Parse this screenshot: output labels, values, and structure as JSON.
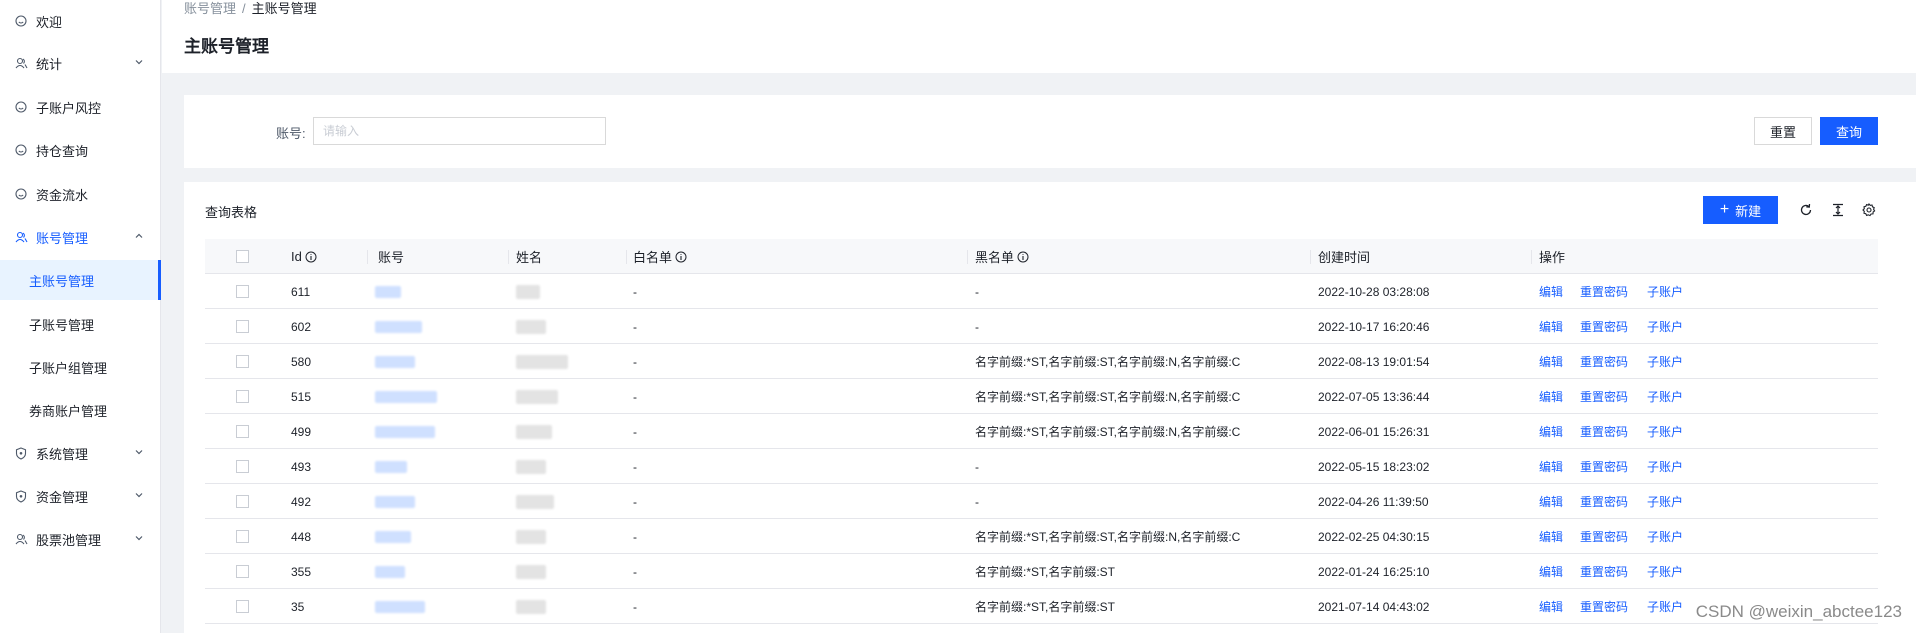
{
  "sidebar": {
    "items": [
      {
        "label": "欢迎",
        "icon": "smile-icon"
      },
      {
        "label": "统计",
        "icon": "user-group-icon",
        "expandable": true
      },
      {
        "label": "子账户风控",
        "icon": "smile-icon"
      },
      {
        "label": "持仓查询",
        "icon": "smile-icon"
      },
      {
        "label": "资金流水",
        "icon": "smile-icon"
      },
      {
        "label": "账号管理",
        "icon": "user-group-icon",
        "expandable": true,
        "open": true
      },
      {
        "label": "主账号管理",
        "sub": true,
        "active": true
      },
      {
        "label": "子账号管理",
        "sub": true
      },
      {
        "label": "子账户组管理",
        "sub": true
      },
      {
        "label": "券商账户管理",
        "sub": true
      },
      {
        "label": "系统管理",
        "icon": "shield-icon",
        "expandable": true
      },
      {
        "label": "资金管理",
        "icon": "shield-icon",
        "expandable": true
      },
      {
        "label": "股票池管理",
        "icon": "user-group-icon",
        "expandable": true
      }
    ]
  },
  "header": {
    "breadcrumb": [
      "账号管理",
      "主账号管理"
    ],
    "title": "主账号管理"
  },
  "search": {
    "label": "账号:",
    "placeholder": "请输入",
    "value": "",
    "reset_label": "重置",
    "query_label": "查询"
  },
  "table": {
    "title": "查询表格",
    "new_label": "新建",
    "tools": [
      "refresh-icon",
      "column-height-icon",
      "settings-icon"
    ],
    "columns": [
      "Id",
      "账号",
      "姓名",
      "白名单",
      "黑名单",
      "创建时间",
      "操作"
    ],
    "actions": [
      "编辑",
      "重置密码",
      "子账户"
    ],
    "rows": [
      {
        "id": "611",
        "whitelist": "-",
        "blacklist": "-",
        "created": "2022-10-28 03:28:08"
      },
      {
        "id": "602",
        "whitelist": "-",
        "blacklist": "-",
        "created": "2022-10-17 16:20:46"
      },
      {
        "id": "580",
        "whitelist": "-",
        "blacklist": "名字前缀:*ST,名字前缀:ST,名字前缀:N,名字前缀:C",
        "created": "2022-08-13 19:01:54"
      },
      {
        "id": "515",
        "whitelist": "-",
        "blacklist": "名字前缀:*ST,名字前缀:ST,名字前缀:N,名字前缀:C",
        "created": "2022-07-05 13:36:44"
      },
      {
        "id": "499",
        "whitelist": "-",
        "blacklist": "名字前缀:*ST,名字前缀:ST,名字前缀:N,名字前缀:C",
        "created": "2022-06-01 15:26:31"
      },
      {
        "id": "493",
        "whitelist": "-",
        "blacklist": "-",
        "created": "2022-05-15 18:23:02"
      },
      {
        "id": "492",
        "whitelist": "-",
        "blacklist": "-",
        "created": "2022-04-26 11:39:50"
      },
      {
        "id": "448",
        "whitelist": "-",
        "blacklist": "名字前缀:*ST,名字前缀:ST,名字前缀:N,名字前缀:C",
        "created": "2022-02-25 04:30:15"
      },
      {
        "id": "355",
        "whitelist": "-",
        "blacklist": "名字前缀:*ST,名字前缀:ST",
        "created": "2022-01-24 16:25:10"
      },
      {
        "id": "35",
        "whitelist": "-",
        "blacklist": "名字前缀:*ST,名字前缀:ST",
        "created": "2021-07-14 04:43:02"
      }
    ]
  },
  "watermark": "CSDN @weixin_abctee123",
  "colors": {
    "accent": "#165dff",
    "border": "#e5e6eb",
    "header_bg": "#f7f8fa",
    "page_bg": "#f0f2f5"
  }
}
